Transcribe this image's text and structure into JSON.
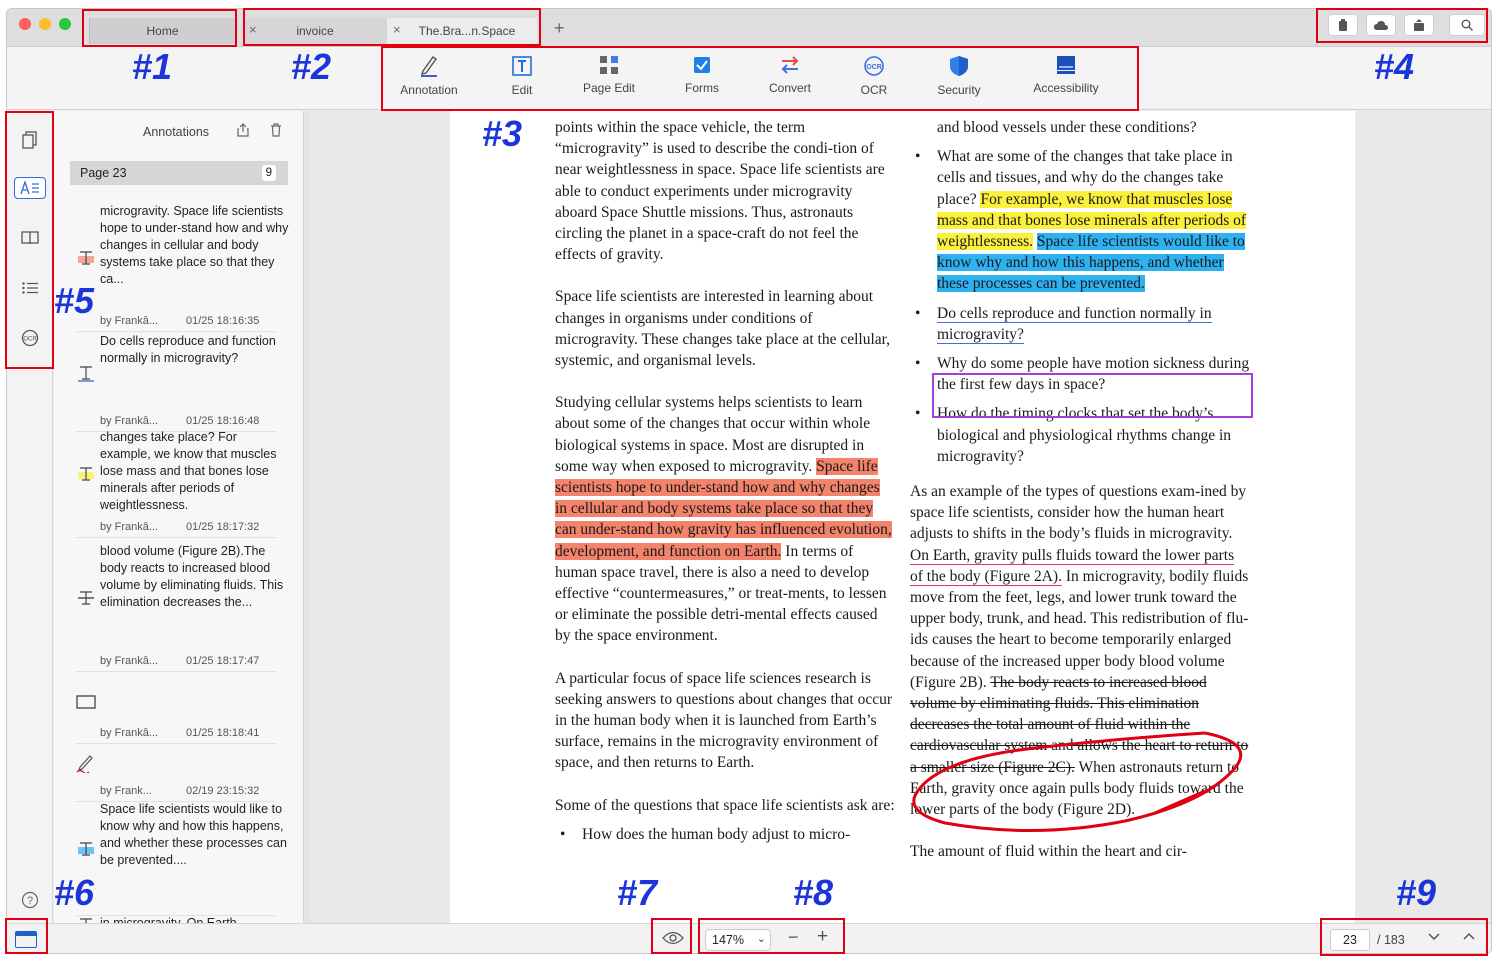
{
  "tabs": [
    {
      "label": "Home"
    },
    {
      "label": "invoice",
      "close": "×"
    },
    {
      "label": "The.Bra...n.Space",
      "close": "×"
    }
  ],
  "new_tab": "+",
  "toolbar": [
    {
      "label": "Annotation",
      "icon": "pen-icon"
    },
    {
      "label": "Edit",
      "icon": "text-edit-icon"
    },
    {
      "label": "Page Edit",
      "icon": "grid-icon"
    },
    {
      "label": "Forms",
      "icon": "checkbox-icon"
    },
    {
      "label": "Convert",
      "icon": "convert-arrows-icon"
    },
    {
      "label": "OCR",
      "icon": "ocr-icon"
    },
    {
      "label": "Security",
      "icon": "shield-icon"
    },
    {
      "label": "Accessibility",
      "icon": "monitor-icon"
    }
  ],
  "panel": {
    "title": "Annotations",
    "page_label": "Page 23",
    "page_count": "9",
    "items": [
      {
        "text": "microgravity. Space life scientists hope to under-stand how and why changes in cellular and body systems take place so that they ca...",
        "author": "by Frankâ...",
        "date": "01/25 18:16:35",
        "color": "#f4836b"
      },
      {
        "text": "Do cells reproduce and function normally in microgravity?",
        "author": "by Frankâ...",
        "date": "01/25 18:16:48",
        "color": "#3d6fd8"
      },
      {
        "text": "changes take place? For example, we know that muscles lose mass and that bones lose minerals after periods of weightlessness.",
        "author": "by Frankâ...",
        "date": "01/25 18:17:32",
        "color": "#fbf03c"
      },
      {
        "text": "blood volume (Figure 2B).The body reacts to increased blood volume by eliminating fluids. This elimination decreases the...",
        "author": "by Frankâ...",
        "date": "01/25 18:17:47",
        "color": "#333"
      },
      {
        "text": "",
        "author": "by Frankâ...",
        "date": "01/25 18:18:41",
        "color": "#333"
      },
      {
        "text": "",
        "author": "by Frank...",
        "date": "02/19 23:15:32",
        "color": "#e00012"
      },
      {
        "text": "Space life scientists would like to know why and how this happens, and whether these processes can be prevented....",
        "author": "",
        "date": "",
        "color": "#2eb1f0"
      },
      {
        "text": "in microgravity. On Earth,",
        "author": "",
        "date": "",
        "color": "#333"
      }
    ]
  },
  "doc": {
    "left_p1": "points within the space vehicle, the term “microgravity” is used to describe the condi-tion of near weightlessness in space. Space life scientists are able to conduct experiments under microgravity aboard Space Shuttle missions. Thus, astronauts circling the planet in a space-craft do not feel the effects of gravity.",
    "left_p2": "Space life scientists are interested in learning about changes in organisms under conditions of microgravity. These changes take place at the cellular, systemic, and organismal levels.",
    "left_p3a": "Studying cellular systems helps scientists to learn about some of the changes that occur within whole biological systems in space. Most are disrupted in some way when exposed to microgravity.",
    "left_p3_hl": "Space life scientists hope to under-stand how and why changes in cellular and body systems take place so that they can under-stand how gravity has influenced evolution, development, and function on Earth.",
    "left_p3b": "In terms of human space travel, there is also a need to develop effective “countermeasures,” or treat-ments, to lessen or eliminate the possible detri-mental effects caused by the space environment.",
    "left_p4": "A particular focus of space life sciences research is seeking answers to questions about changes that occur in the human body when it is launched from Earth’s surface, remains in the microgravity environment of space, and then returns to Earth.",
    "left_p5": "Some of the questions that space life scientists ask are:",
    "left_b1": "How does the human body adjust to micro-",
    "right_top": "and blood vessels under these conditions?",
    "right_b1a": "What are some of the changes that take place in cells and tissues, and why do the changes take place?",
    "right_b1_yel": "For example, we know that muscles lose mass and that bones lose minerals after periods of weightlessness.",
    "right_b1_blue": "Space life scientists would like to know why and how this happens, and whether these processes can be prevented.",
    "right_b2": "Do cells reproduce and function normally in microgravity?",
    "right_b3": "Why do some people have motion sickness during the first few days in space?",
    "right_b4": "How do the timing clocks that set the body’s biological and physiological rhythms change in microgravity?",
    "right_p1a": "As an example of the types of questions exam-ined by space life scientists, consider how the human heart adjusts to shifts in the body’s fluids in microgravity.",
    "right_p1_ul": "On Earth, gravity pulls fluids toward the lower parts of the body (Figure 2A).",
    "right_p1b": "In microgravity, bodily fluids move from the feet, legs, and lower trunk toward the upper body, trunk, and head. This redistribution of flu-ids causes the heart to become temporarily enlarged because of the increased upper body blood volume (Figure 2B).",
    "right_p1_strike": "The body reacts to increased blood volume by eliminating fluids. This elimination decreases the total amount of fluid within the cardiovascular system and allows the heart to return to a smaller size (Figure 2C).",
    "right_p1c": "When astronauts return to Earth, gravity once again pulls body fluids toward the lower parts of the body (Figure 2D).",
    "right_p2": "The amount of fluid within the heart and cir-"
  },
  "bottom": {
    "zoom": "147%",
    "zoom_minus": "−",
    "zoom_plus": "+",
    "page_current": "23",
    "page_total": "/ 183"
  },
  "markers": [
    "#1",
    "#2",
    "#3",
    "#4",
    "#5",
    "#6",
    "#7",
    "#8",
    "#9"
  ],
  "colors": {
    "callout_red": "#e00012",
    "marker_blue": "#1b35d8",
    "highlight_red": "#f4836b",
    "highlight_yellow": "#fbf03c",
    "highlight_blue": "#2eb1f0",
    "purple_box": "#a040e0"
  }
}
